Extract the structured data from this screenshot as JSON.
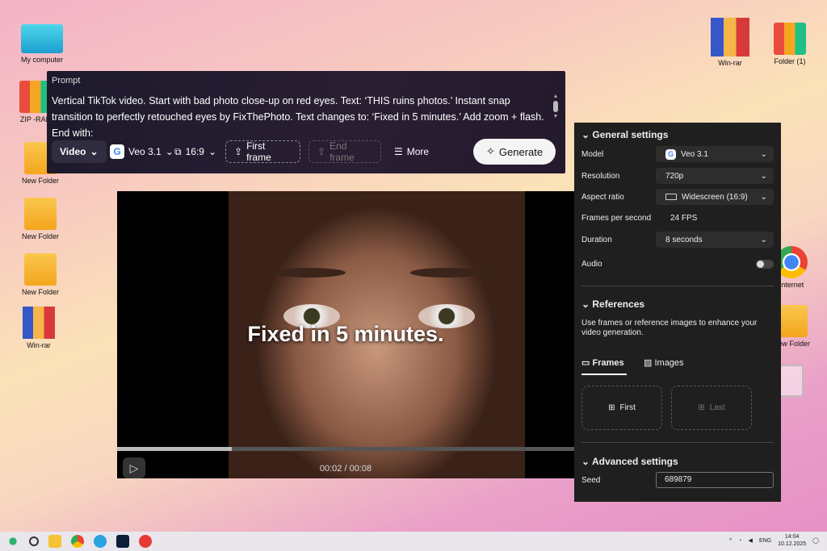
{
  "desktop": {
    "left_icons": [
      "My computer",
      "ZIP -RAR",
      "New Folder",
      "New Folder",
      "New Folder",
      "Win-rar"
    ],
    "right_icons": [
      "Win-rar",
      "Folder (1)",
      "Internet",
      "New Folder"
    ]
  },
  "prompt": {
    "label": "Prompt",
    "text": "Vertical TikTok video. Start with bad photo close-up on red eyes. Text: ‘THIS ruins photos.’ Instant snap transition to perfectly retouched eyes by FixThePhoto. Text changes to: ‘Fixed in 5 minutes.’ Add zoom + flash. End with:",
    "mode": "Video",
    "model": "Veo 3.1",
    "aspect": "16:9",
    "first_frame": "First frame",
    "end_frame": "End frame",
    "more": "More",
    "generate": "Generate"
  },
  "video": {
    "overlay_text": "Fixed in 5 minutes.",
    "time": "00:02 / 00:08",
    "progress": 0.25
  },
  "settings": {
    "general_title": "General settings",
    "model_label": "Model",
    "model": "Veo 3.1",
    "resolution_label": "Resolution",
    "resolution": "720p",
    "aspect_label": "Aspect ratio",
    "aspect": "Widescreen (16:9)",
    "fps_label": "Frames per second",
    "fps": "24 FPS",
    "duration_label": "Duration",
    "duration": "8 seconds",
    "audio_label": "Audio",
    "audio_on": false,
    "references_title": "References",
    "references_desc": "Use frames or reference images to enhance your video generation.",
    "tab_frames": "Frames",
    "tab_images": "Images",
    "first": "First",
    "last": "Last",
    "advanced_title": "Advanced settings",
    "seed_label": "Seed",
    "seed": "689879"
  },
  "tray": {
    "lang": "ENG",
    "time": "14:04",
    "date": "10.12.2025"
  }
}
